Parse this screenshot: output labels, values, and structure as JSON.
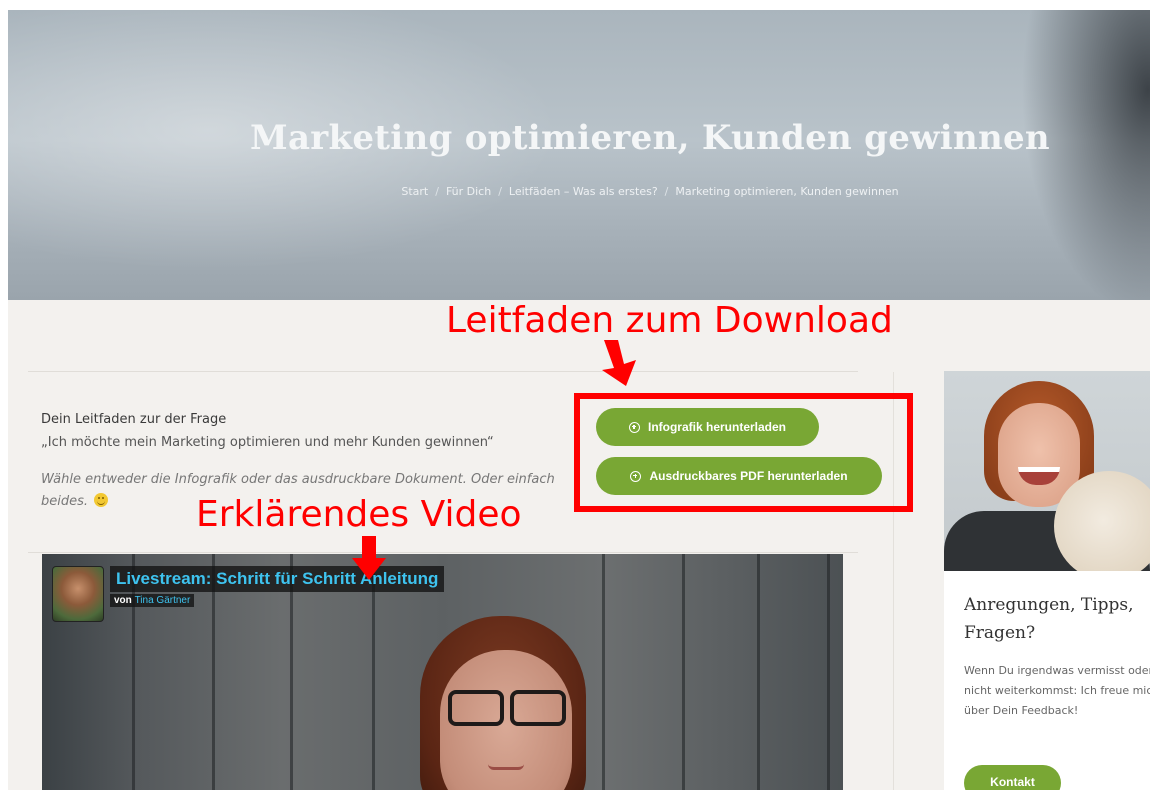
{
  "hero": {
    "title": "Marketing optimieren, Kunden gewinnen",
    "breadcrumb": [
      "Start",
      "Für Dich",
      "Leitfäden – Was als erstes?",
      "Marketing optimieren, Kunden gewinnen"
    ]
  },
  "guide": {
    "heading": "Dein Leitfaden zur der Frage",
    "quote": "„Ich möchte mein Marketing optimieren und mehr Kunden gewinnen“",
    "hint": "Wähle entweder die Infografik oder das ausdruckbare Dokument. Oder einfach beides.",
    "smiley_icon": "smiley-icon"
  },
  "downloads": {
    "infografik_label": "Infografik herunterladen",
    "pdf_label": "Ausdruckbares PDF herunterladen",
    "icon": "plus-circle-icon",
    "color": "#79a734"
  },
  "annotations": {
    "download": "Leitfaden zum Download",
    "video": "Erklärendes Video",
    "color": "#ff0000"
  },
  "video": {
    "title": "Livestream: Schritt für Schritt Anleitung",
    "by_prefix": "von",
    "author": "Tina Gärtner",
    "title_color": "#3ec3ef"
  },
  "sidebar": {
    "heading": "Anregungen, Tipps, Fragen?",
    "text_lines": [
      "Wenn Du irgendwas vermisst oder",
      "nicht weiterkommst: Ich freue mich",
      "über Dein Feedback!"
    ],
    "button_label": "Kontakt"
  }
}
